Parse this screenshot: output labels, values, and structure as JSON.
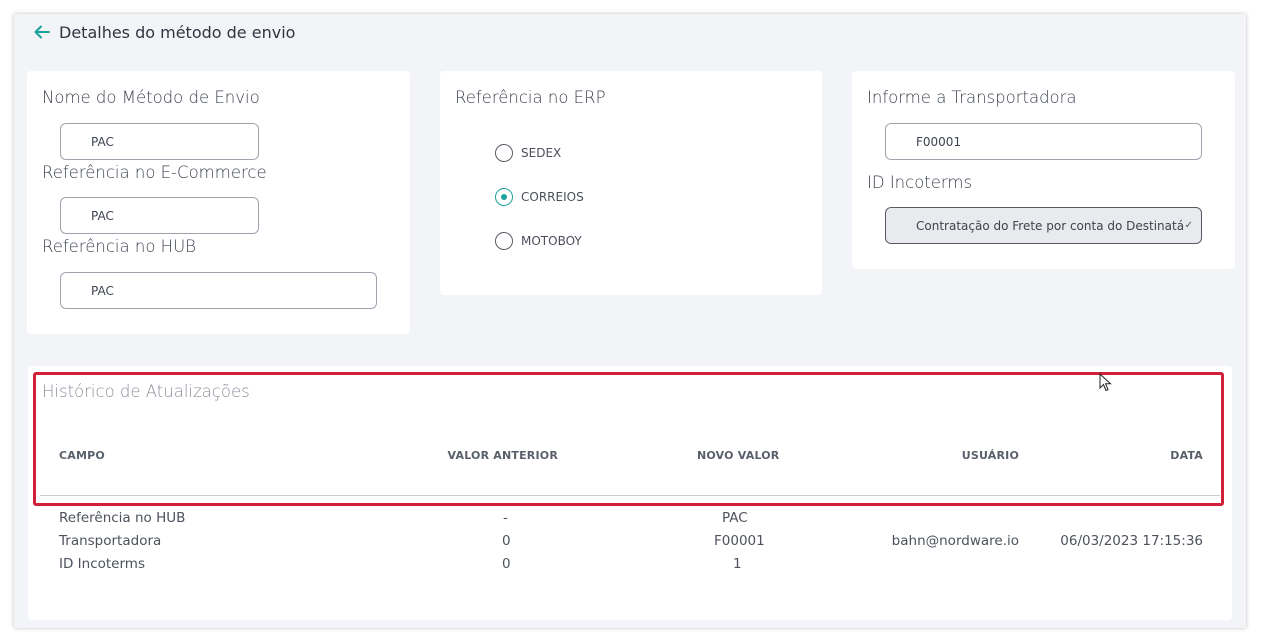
{
  "header": {
    "title": "Detalhes do método de envio",
    "back_icon": "arrow-left-icon"
  },
  "colors": {
    "accent": "#1aa19c",
    "highlight": "#d0203a"
  },
  "card_names": {
    "name_label": "Nome do Método de Envio",
    "name_value": "PAC",
    "ecommerce_label": "Referência no E-Commerce",
    "ecommerce_value": "PAC",
    "hub_label": "Referência no HUB",
    "hub_value": "PAC"
  },
  "card_erp": {
    "label": "Referência no ERP",
    "options": [
      {
        "label": "SEDEX",
        "checked": false
      },
      {
        "label": "CORREIOS",
        "checked": true
      },
      {
        "label": "MOTOBOY",
        "checked": false
      }
    ]
  },
  "card_carrier": {
    "carrier_label": "Informe a Transportadora",
    "carrier_value": "F00001",
    "incoterms_label": "ID Incoterms",
    "incoterms_value": "Contratação do Frete por conta do Destinatá"
  },
  "history": {
    "title": "Histórico de Atualizações",
    "columns": [
      "CAMPO",
      "VALOR ANTERIOR",
      "NOVO VALOR",
      "USUÁRIO",
      "DATA"
    ],
    "rows": [
      {
        "campo": "Referência no HUB",
        "anterior": "-",
        "novo": "PAC",
        "usuario": "",
        "data": ""
      },
      {
        "campo": "Transportadora",
        "anterior": "0",
        "novo": "F00001",
        "usuario": "bahn@nordware.io",
        "data": "06/03/2023 17:15:36"
      },
      {
        "campo": "ID Incoterms",
        "anterior": "0",
        "novo": "1",
        "usuario": "",
        "data": ""
      }
    ]
  }
}
